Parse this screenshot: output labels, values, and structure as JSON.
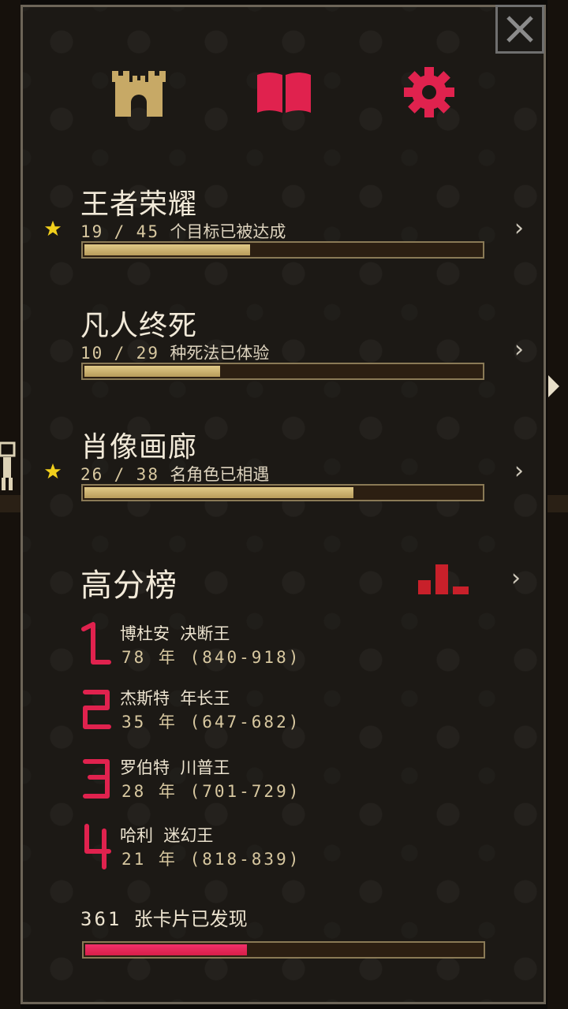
{
  "tabs": [
    {
      "name": "castle",
      "icon": "castle-icon",
      "color": "#c7a966"
    },
    {
      "name": "book",
      "icon": "book-icon",
      "color": "#e0224e"
    },
    {
      "name": "settings",
      "icon": "gear-icon",
      "color": "#e0224e"
    }
  ],
  "sections": [
    {
      "title": "王者荣耀",
      "current": "19",
      "total": "45",
      "separator": "/",
      "suffix": "个目标已被达成",
      "progress": 0.42,
      "starred": true
    },
    {
      "title": "凡人终死",
      "current": "10",
      "total": "29",
      "separator": "/",
      "suffix": "种死法已体验",
      "progress": 0.345,
      "starred": false
    },
    {
      "title": "肖像画廊",
      "current": "26",
      "total": "38",
      "separator": "/",
      "suffix": "名角色已相遇",
      "progress": 0.684,
      "starred": true
    }
  ],
  "leaderboard": {
    "title": "高分榜",
    "entries": [
      {
        "rank": "1",
        "name": "博杜安  决断王",
        "years": "78 年 (840-918)"
      },
      {
        "rank": "2",
        "name": "杰斯特  年长王",
        "years": "35 年 (647-682)"
      },
      {
        "rank": "3",
        "name": "罗伯特  川普王",
        "years": "28 年 (701-729)"
      },
      {
        "rank": "4",
        "name": "哈利  迷幻王",
        "years": "21 年 (818-839)"
      }
    ]
  },
  "cards": {
    "count": "361",
    "label": "张卡片已发现",
    "progress": 0.41
  },
  "colors": {
    "accent_red": "#e0224e",
    "gold": "#c7a966",
    "bar_gold": "#d2ba78",
    "chart_red": "#c8202a"
  }
}
